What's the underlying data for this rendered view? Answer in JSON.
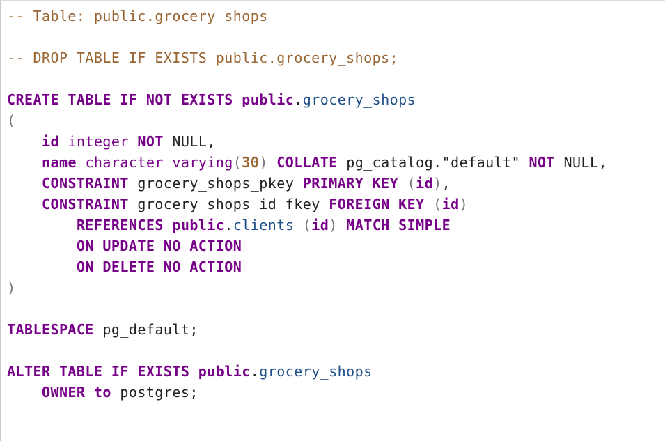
{
  "editor": {
    "theme": {
      "comment": "#996633",
      "keyword": "#770088",
      "name": "#1f4f8a",
      "number": "#996633",
      "bracket": "#777777",
      "plain": "#222222"
    },
    "lines": [
      [
        {
          "t": "-- Table: public.grocery_shops",
          "c": "comment"
        }
      ],
      [],
      [
        {
          "t": "-- DROP TABLE IF EXISTS public.grocery_shops;",
          "c": "comment"
        }
      ],
      [],
      [
        {
          "t": "CREATE TABLE IF NOT EXISTS public",
          "c": "keyword"
        },
        {
          "t": ".",
          "c": "plain"
        },
        {
          "t": "grocery_shops",
          "c": "name"
        }
      ],
      [
        {
          "t": "(",
          "c": "bracket"
        }
      ],
      [
        {
          "t": "    ",
          "c": "plain"
        },
        {
          "t": "id",
          "c": "keyword"
        },
        {
          "t": " ",
          "c": "plain"
        },
        {
          "t": "integer",
          "c": "type"
        },
        {
          "t": " ",
          "c": "plain"
        },
        {
          "t": "NOT",
          "c": "keyword"
        },
        {
          "t": " NULL,",
          "c": "plain"
        }
      ],
      [
        {
          "t": "    ",
          "c": "plain"
        },
        {
          "t": "name",
          "c": "keyword"
        },
        {
          "t": " ",
          "c": "plain"
        },
        {
          "t": "character varying",
          "c": "type"
        },
        {
          "t": "(",
          "c": "bracket"
        },
        {
          "t": "30",
          "c": "number"
        },
        {
          "t": ")",
          "c": "bracket"
        },
        {
          "t": " ",
          "c": "plain"
        },
        {
          "t": "COLLATE",
          "c": "keyword"
        },
        {
          "t": " pg_catalog.\"default\" ",
          "c": "plain"
        },
        {
          "t": "NOT",
          "c": "keyword"
        },
        {
          "t": " NULL,",
          "c": "plain"
        }
      ],
      [
        {
          "t": "    ",
          "c": "plain"
        },
        {
          "t": "CONSTRAINT",
          "c": "keyword"
        },
        {
          "t": " grocery_shops_pkey ",
          "c": "plain"
        },
        {
          "t": "PRIMARY KEY",
          "c": "keyword"
        },
        {
          "t": " ",
          "c": "plain"
        },
        {
          "t": "(",
          "c": "bracket"
        },
        {
          "t": "id",
          "c": "keyword"
        },
        {
          "t": ")",
          "c": "bracket"
        },
        {
          "t": ",",
          "c": "plain"
        }
      ],
      [
        {
          "t": "    ",
          "c": "plain"
        },
        {
          "t": "CONSTRAINT",
          "c": "keyword"
        },
        {
          "t": " grocery_shops_id_fkey ",
          "c": "plain"
        },
        {
          "t": "FOREIGN KEY",
          "c": "keyword"
        },
        {
          "t": " ",
          "c": "plain"
        },
        {
          "t": "(",
          "c": "bracket"
        },
        {
          "t": "id",
          "c": "keyword"
        },
        {
          "t": ")",
          "c": "bracket"
        }
      ],
      [
        {
          "t": "        ",
          "c": "plain"
        },
        {
          "t": "REFERENCES",
          "c": "keyword"
        },
        {
          "t": " ",
          "c": "plain"
        },
        {
          "t": "public",
          "c": "keyword"
        },
        {
          "t": ".",
          "c": "plain"
        },
        {
          "t": "clients",
          "c": "name"
        },
        {
          "t": " ",
          "c": "plain"
        },
        {
          "t": "(",
          "c": "bracket"
        },
        {
          "t": "id",
          "c": "keyword"
        },
        {
          "t": ")",
          "c": "bracket"
        },
        {
          "t": " ",
          "c": "plain"
        },
        {
          "t": "MATCH SIMPLE",
          "c": "keyword"
        }
      ],
      [
        {
          "t": "        ",
          "c": "plain"
        },
        {
          "t": "ON UPDATE NO ACTION",
          "c": "keyword"
        }
      ],
      [
        {
          "t": "        ",
          "c": "plain"
        },
        {
          "t": "ON DELETE NO ACTION",
          "c": "keyword"
        }
      ],
      [
        {
          "t": ")",
          "c": "bracket"
        }
      ],
      [],
      [
        {
          "t": "TABLESPACE",
          "c": "keyword"
        },
        {
          "t": " pg_default;",
          "c": "plain"
        }
      ],
      [],
      [
        {
          "t": "ALTER TABLE IF EXISTS public",
          "c": "keyword"
        },
        {
          "t": ".",
          "c": "plain"
        },
        {
          "t": "grocery_shops",
          "c": "name"
        }
      ],
      [
        {
          "t": "    ",
          "c": "plain"
        },
        {
          "t": "OWNER to",
          "c": "keyword"
        },
        {
          "t": " postgres;",
          "c": "plain"
        }
      ]
    ]
  }
}
